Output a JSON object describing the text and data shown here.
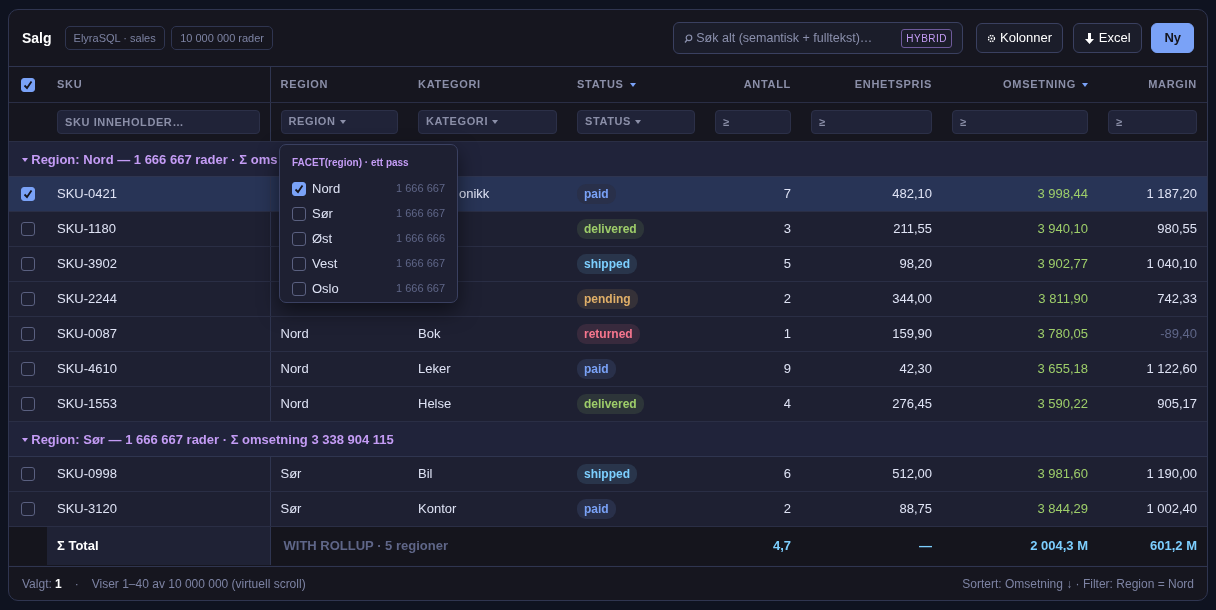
{
  "header": {
    "title": "Salg",
    "chips": [
      "ElyraSQL · sales",
      "10 000 000 rader"
    ],
    "search": {
      "placeholder": "Søk alt (semantisk + fulltekst)…",
      "badge": "HYBRID"
    },
    "buttons": [
      {
        "label": "Kolonner",
        "kind": "gear"
      },
      {
        "label": "Excel",
        "kind": "download"
      },
      {
        "label": "Ny",
        "kind": "primary"
      }
    ]
  },
  "table": {
    "select_all": {
      "checked": true
    },
    "columns": [
      {
        "label": "SKU",
        "kind": "text",
        "sorted": false,
        "filter": {
          "kind": "text",
          "placeholder": "SKU INNEHOLDER…"
        }
      },
      {
        "label": "REGION",
        "kind": "text",
        "sorted": false,
        "filter": {
          "kind": "select",
          "label": "REGION"
        }
      },
      {
        "label": "KATEGORI",
        "kind": "text",
        "sorted": false,
        "filter": {
          "kind": "select",
          "label": "KATEGORI"
        }
      },
      {
        "label": "STATUS",
        "kind": "badge",
        "sorted": true,
        "filter": {
          "kind": "select",
          "label": "STATUS"
        }
      },
      {
        "label": "ANTALL",
        "kind": "number",
        "sorted": false,
        "filter": {
          "kind": "number",
          "placeholder": "≥"
        }
      },
      {
        "label": "ENHETSPRIS",
        "kind": "number",
        "sorted": false,
        "filter": {
          "kind": "number",
          "placeholder": "≥"
        }
      },
      {
        "label": "OMSETNING",
        "kind": "money",
        "sorted": true,
        "filter": {
          "kind": "number",
          "placeholder": "≥"
        }
      },
      {
        "label": "MARGIN",
        "kind": "number",
        "sorted": false,
        "filter": {
          "kind": "number",
          "placeholder": "≥"
        }
      }
    ],
    "groups": [
      {
        "label": "Region: Nord — 1 666 667 rader · Σ oms",
        "expanded": true,
        "rows": [
          {
            "selected": true,
            "cells": [
              "SKU-0421",
              null,
              "onikk",
              "paid",
              "7",
              "482,10",
              "3 998,44",
              "1 187,20"
            ],
            "color": "#7aa2f7",
            "dimmed": false
          },
          {
            "selected": false,
            "cells": [
              "SKU-1180",
              null,
              null,
              "delivered",
              "3",
              "211,55",
              "3 940,10",
              "980,55"
            ],
            "color": "#9ece6a",
            "dimmed": false
          },
          {
            "selected": false,
            "cells": [
              "SKU-3902",
              null,
              null,
              "shipped",
              "5",
              "98,20",
              "3 902,77",
              "1 040,10"
            ],
            "color": "#7dcfff",
            "dimmed": false
          },
          {
            "selected": false,
            "cells": [
              "SKU-2244",
              null,
              null,
              "pending",
              "2",
              "344,00",
              "3 811,90",
              "742,33"
            ],
            "color": "#e0af68",
            "dimmed": false
          },
          {
            "selected": false,
            "cells": [
              "SKU-0087",
              "Nord",
              "Bok",
              "returned",
              "1",
              "159,90",
              "3 780,05",
              "-89,40"
            ],
            "color": "#f7768e",
            "dimmed": true
          },
          {
            "selected": false,
            "cells": [
              "SKU-4610",
              "Nord",
              "Leker",
              "paid",
              "9",
              "42,30",
              "3 655,18",
              "1 122,60"
            ],
            "color": "#7aa2f7",
            "dimmed": false
          },
          {
            "selected": false,
            "cells": [
              "SKU-1553",
              "Nord",
              "Helse",
              "delivered",
              "4",
              "276,45",
              "3 590,22",
              "905,17"
            ],
            "color": "#9ece6a",
            "dimmed": false
          }
        ]
      },
      {
        "label": "Region: Sør — 1 666 667 rader · Σ omsetning 3 338 904 115",
        "expanded": true,
        "rows": [
          {
            "selected": false,
            "cells": [
              "SKU-0998",
              "Sør",
              "Bil",
              "shipped",
              "6",
              "512,00",
              "3 981,60",
              "1 190,00"
            ],
            "color": "#7dcfff",
            "dimmed": false
          },
          {
            "selected": false,
            "cells": [
              "SKU-3120",
              "Sør",
              "Kontor",
              "paid",
              "2",
              "88,75",
              "3 844,29",
              "1 002,40"
            ],
            "color": "#7aa2f7",
            "dimmed": false
          }
        ]
      }
    ],
    "total": {
      "label": "Σ Total",
      "note": "WITH ROLLUP · 5 regioner",
      "values": [
        "4,7",
        "—",
        "2 004,3 M",
        "601,2 M"
      ]
    }
  },
  "facet": {
    "title": "FACET(region) · ett pass",
    "items": [
      {
        "label": "Nord",
        "count": "1 666 667",
        "checked": true
      },
      {
        "label": "Sør",
        "count": "1 666 667",
        "checked": false
      },
      {
        "label": "Øst",
        "count": "1 666 666",
        "checked": false
      },
      {
        "label": "Vest",
        "count": "1 666 667",
        "checked": false
      },
      {
        "label": "Oslo",
        "count": "1 666 667",
        "checked": false
      }
    ]
  },
  "status_bar": {
    "selected_label": "Valgt:",
    "selected_count": "1",
    "separator": "·",
    "range": "Viser 1–40 av 10 000 000 (virtuell scroll)",
    "summary": "Sortert: Omsetning ↓ · Filter: Region = Nord"
  }
}
